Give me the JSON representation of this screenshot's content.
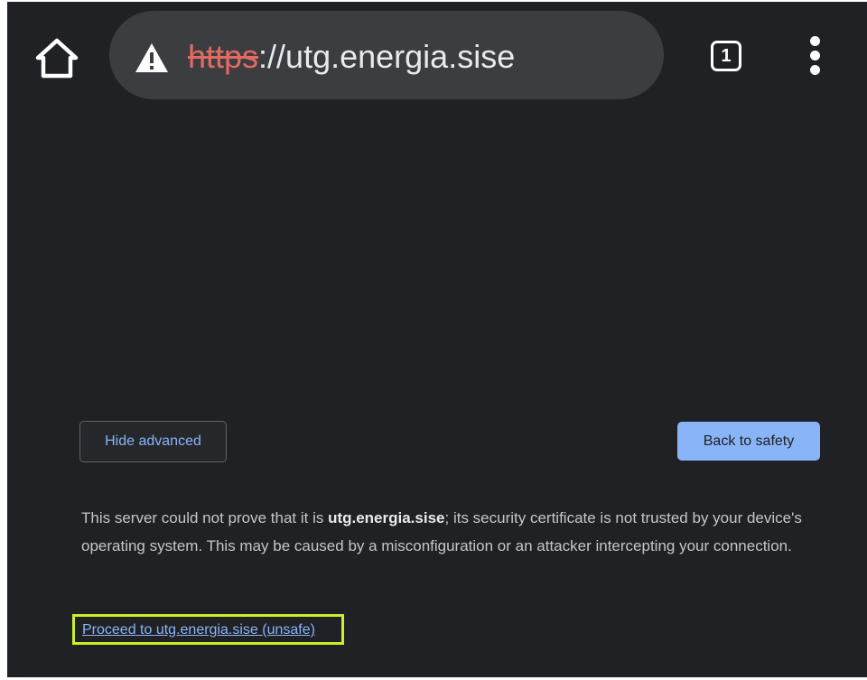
{
  "toolbar": {
    "home_icon": "home-icon",
    "omnibox": {
      "warning_icon": "warning-triangle-icon",
      "url_scheme": "https",
      "url_rest": "://utg.energia.sise"
    },
    "tab_count": "1",
    "menu_icon": "more-vert-icon"
  },
  "interstitial": {
    "hide_advanced_label": "Hide advanced",
    "back_to_safety_label": "Back to safety",
    "explanation": {
      "before": "This server could not prove that it is ",
      "domain": "utg.energia.sise",
      "after": "; its security certificate is not trusted by your device's operating system. This may be caused by a misconfiguration or an attacker intercepting your connection."
    },
    "proceed_link_label": "Proceed to utg.energia.sise (unsafe)"
  },
  "colors": {
    "page_background": "#202124",
    "omnibox_background": "#3c3d40",
    "insecure_scheme": "#e46962",
    "primary_button": "#8ab4f8",
    "link": "#8ab4f8",
    "highlight_outline": "#c9f02a"
  }
}
